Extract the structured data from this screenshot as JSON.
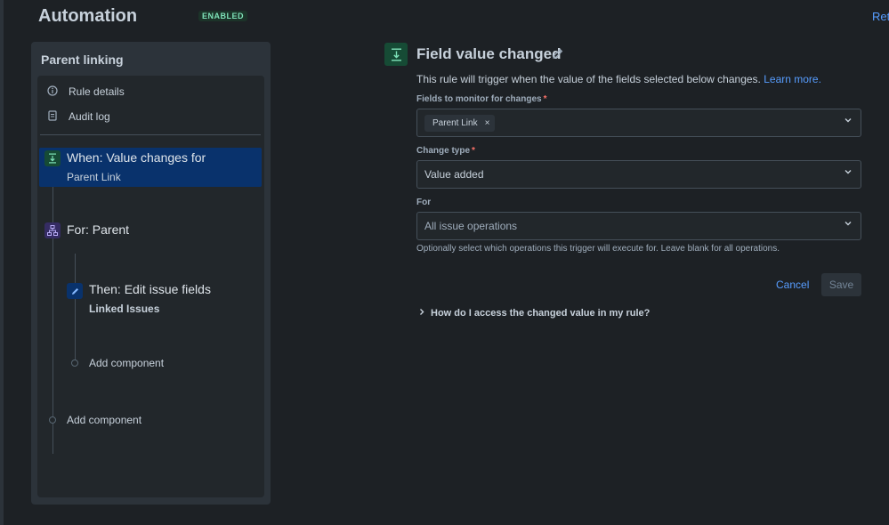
{
  "header": {
    "title": "Automation",
    "status_badge": "ENABLED",
    "right_link": "Ret"
  },
  "sidebar": {
    "title": "Parent linking",
    "menu": [
      {
        "label": "Rule details",
        "icon": "info-icon"
      },
      {
        "label": "Audit log",
        "icon": "document-icon"
      }
    ],
    "trigger": {
      "title": "When: Value changes for",
      "subtitle": "Parent Link",
      "icon": "field-trigger-icon"
    },
    "branch": {
      "title": "For: Parent",
      "icon": "branch-icon"
    },
    "action": {
      "title": "Then: Edit issue fields",
      "subtitle": "Linked Issues",
      "icon": "pencil-icon"
    },
    "add_component_inner": "Add component",
    "add_component_outer": "Add component"
  },
  "main": {
    "title": "Field value changed",
    "description": "This rule will trigger when the value of the fields selected below changes.",
    "learn_more": "Learn more.",
    "fields_label": "Fields to monitor for changes",
    "fields_tag": "Parent Link",
    "tag_remove": "×",
    "change_type_label": "Change type",
    "change_type_value": "Value added",
    "for_label": "For",
    "for_placeholder": "All issue operations",
    "for_hint": "Optionally select which operations this trigger will execute for. Leave blank for all operations.",
    "required_marker": "*",
    "cancel_label": "Cancel",
    "save_label": "Save",
    "accordion_label": "How do I access the changed value in my rule?"
  },
  "colors": {
    "background": "#1d2125",
    "panel": "#2c333a",
    "selected": "#09326c",
    "link": "#579dff",
    "success": "#7ee2b8",
    "required": "#f87168"
  }
}
